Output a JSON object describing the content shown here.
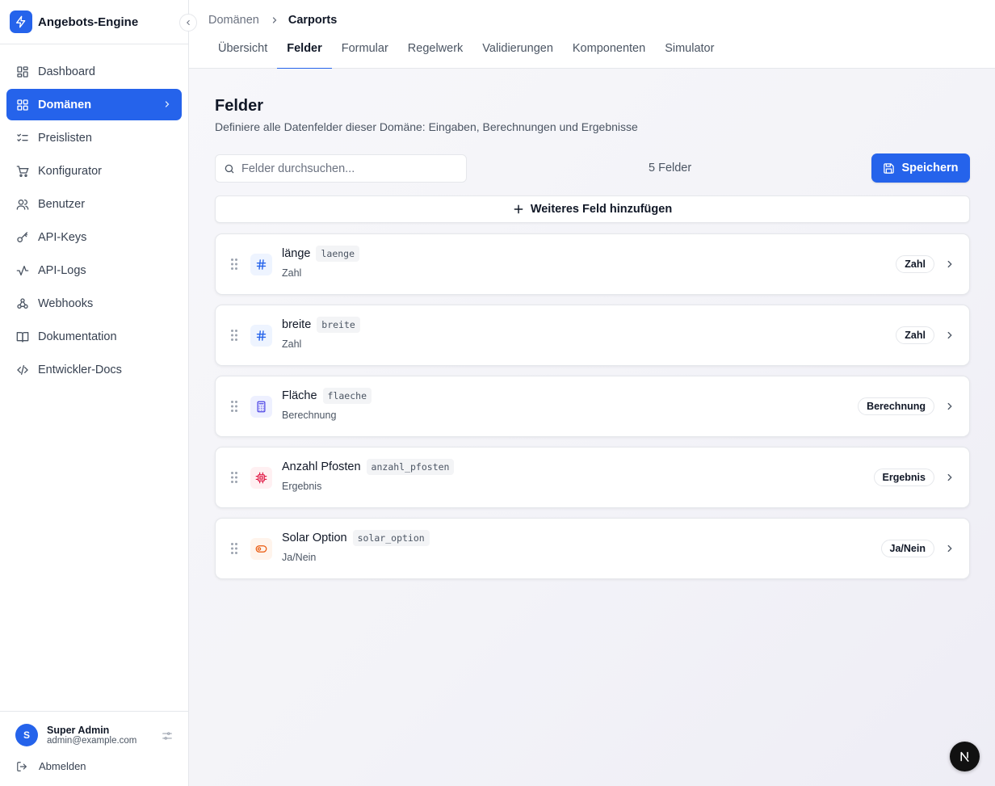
{
  "app": {
    "title": "Angebots-Engine"
  },
  "sidebar": {
    "items": [
      {
        "label": "Dashboard",
        "icon": "dashboard-icon"
      },
      {
        "label": "Domänen",
        "icon": "domains-icon",
        "active": true
      },
      {
        "label": "Preislisten",
        "icon": "list-check-icon"
      },
      {
        "label": "Konfigurator",
        "icon": "cart-icon"
      },
      {
        "label": "Benutzer",
        "icon": "users-icon"
      },
      {
        "label": "API-Keys",
        "icon": "key-icon"
      },
      {
        "label": "API-Logs",
        "icon": "activity-icon"
      },
      {
        "label": "Webhooks",
        "icon": "webhook-icon"
      },
      {
        "label": "Dokumentation",
        "icon": "book-icon"
      },
      {
        "label": "Entwickler-Docs",
        "icon": "code-icon"
      }
    ],
    "user": {
      "initial": "S",
      "name": "Super Admin",
      "email": "admin@example.com"
    },
    "logout_label": "Abmelden"
  },
  "breadcrumb": {
    "parent": "Domänen",
    "current": "Carports"
  },
  "tabs": [
    {
      "label": "Übersicht"
    },
    {
      "label": "Felder",
      "active": true
    },
    {
      "label": "Formular"
    },
    {
      "label": "Regelwerk"
    },
    {
      "label": "Validierungen"
    },
    {
      "label": "Komponenten"
    },
    {
      "label": "Simulator"
    }
  ],
  "main": {
    "title": "Felder",
    "subtitle": "Definiere alle Datenfelder dieser Domäne: Eingaben, Berechnungen und Ergebnisse",
    "search": {
      "placeholder": "Felder durchsuchen...",
      "value": ""
    },
    "count_label": "5 Felder",
    "save_label": "Speichern",
    "add_label": "Weiteres Feld hinzufügen"
  },
  "fields": [
    {
      "name": "länge",
      "key": "laenge",
      "type": "Zahl",
      "badge": "Zahl",
      "icon": "hash-icon",
      "icon_color": "#2563eb",
      "icon_bg": "#eef4ff"
    },
    {
      "name": "breite",
      "key": "breite",
      "type": "Zahl",
      "badge": "Zahl",
      "icon": "hash-icon",
      "icon_color": "#2563eb",
      "icon_bg": "#eef4ff"
    },
    {
      "name": "Fläche",
      "key": "flaeche",
      "type": "Berechnung",
      "badge": "Berechnung",
      "icon": "calculator-icon",
      "icon_color": "#4f46e5",
      "icon_bg": "#eef0ff"
    },
    {
      "name": "Anzahl Pfosten",
      "key": "anzahl_pfosten",
      "type": "Ergebnis",
      "badge": "Ergebnis",
      "icon": "chip-icon",
      "icon_color": "#e11d48",
      "icon_bg": "#fff0f2"
    },
    {
      "name": "Solar Option",
      "key": "solar_option",
      "type": "Ja/Nein",
      "badge": "Ja/Nein",
      "icon": "toggle-icon",
      "icon_color": "#ea580c",
      "icon_bg": "#fff4ec"
    }
  ],
  "colors": {
    "accent": "#2563eb",
    "text": "#111827",
    "muted": "#4b5563",
    "border": "#e5e7eb"
  }
}
